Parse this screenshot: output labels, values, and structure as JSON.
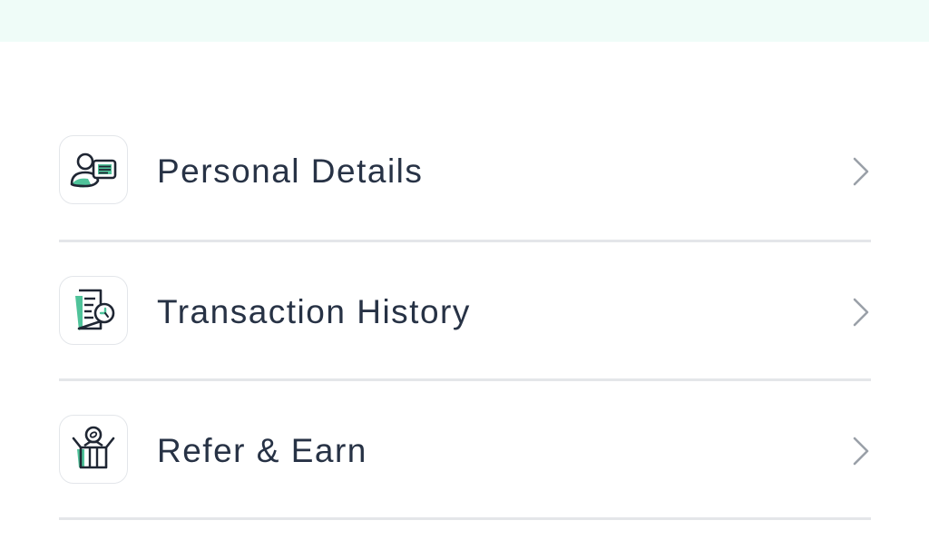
{
  "menu": {
    "items": [
      {
        "label": "Personal Details",
        "icon": "personal-details-icon"
      },
      {
        "label": "Transaction History",
        "icon": "transaction-history-icon"
      },
      {
        "label": "Refer & Earn",
        "icon": "refer-earn-icon"
      }
    ]
  },
  "colors": {
    "top_band": "#effcf8",
    "text": "#273245",
    "accent_green": "#4fc39a",
    "divider": "#e4e6e9",
    "chevron": "#9aa0a8"
  }
}
